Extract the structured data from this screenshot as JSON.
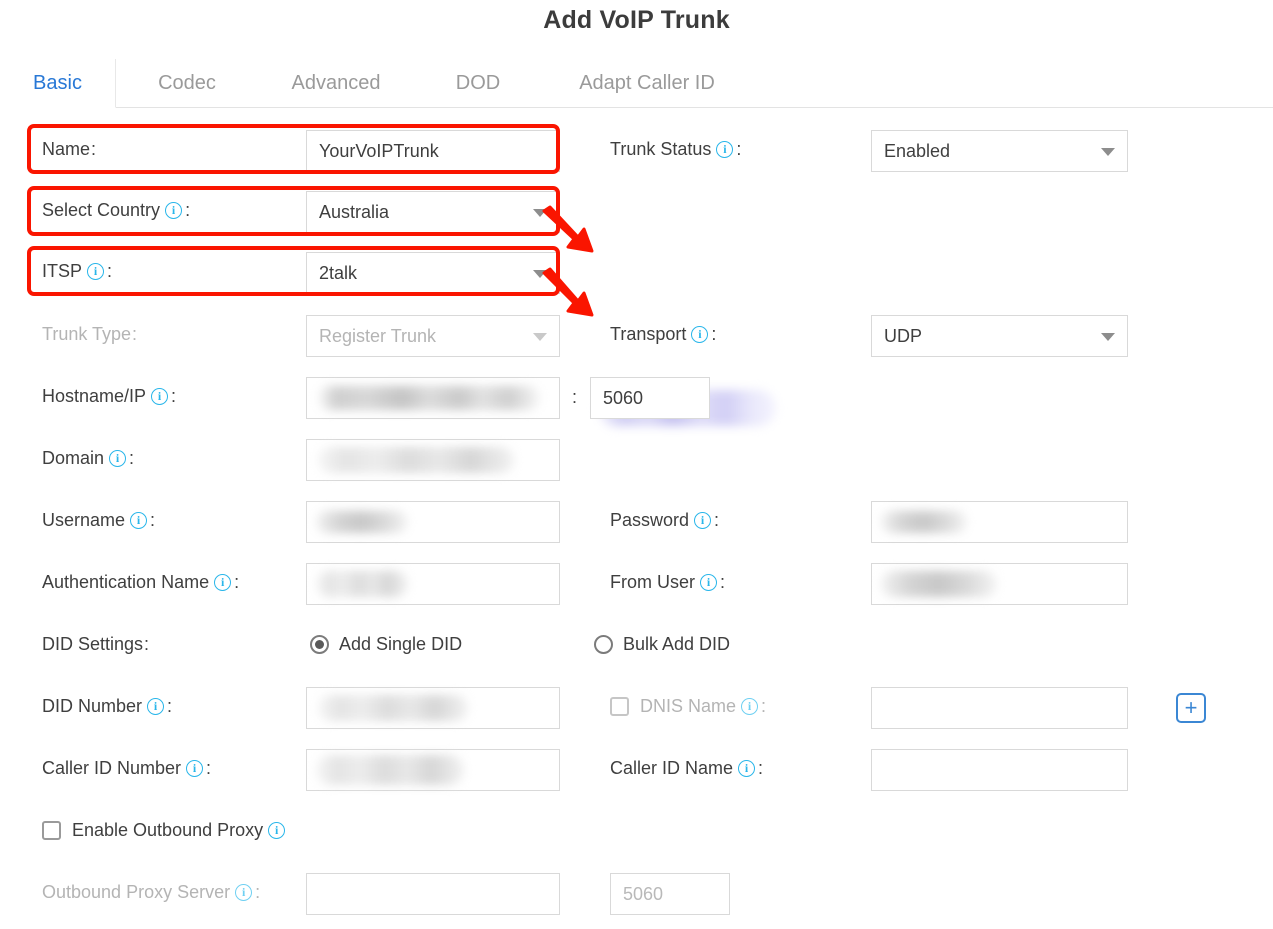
{
  "header": {
    "title": "Add VoIP Trunk"
  },
  "tabs": [
    {
      "label": "Basic",
      "active": true
    },
    {
      "label": "Codec",
      "active": false
    },
    {
      "label": "Advanced",
      "active": false
    },
    {
      "label": "DOD",
      "active": false
    },
    {
      "label": "Adapt Caller ID",
      "active": false
    }
  ],
  "form": {
    "name": {
      "label": "Name",
      "value": "YourVoIPTrunk",
      "has_info": false
    },
    "trunk_status": {
      "label": "Trunk Status",
      "value": "Enabled",
      "has_info": true
    },
    "select_country": {
      "label": "Select Country",
      "value": "Australia",
      "has_info": true
    },
    "itsp": {
      "label": "ITSP",
      "value": "2talk",
      "has_info": true
    },
    "trunk_type": {
      "label": "Trunk Type",
      "value": "Register Trunk",
      "has_info": false,
      "disabled": true
    },
    "transport": {
      "label": "Transport",
      "value": "UDP",
      "has_info": true
    },
    "hostname_ip": {
      "label": "Hostname/IP",
      "value": "",
      "has_info": true,
      "redacted": true
    },
    "hostname_port": {
      "value": "5060"
    },
    "domain": {
      "label": "Domain",
      "value": "",
      "has_info": true,
      "redacted": true
    },
    "username": {
      "label": "Username",
      "value": "",
      "has_info": true,
      "redacted": true
    },
    "password": {
      "label": "Password",
      "value": "",
      "has_info": true,
      "redacted": true
    },
    "auth_name": {
      "label": "Authentication Name",
      "value": "",
      "has_info": true,
      "redacted": true
    },
    "from_user": {
      "label": "From User",
      "value": "",
      "has_info": true,
      "redacted": true
    },
    "did_settings": {
      "label": "DID Settings"
    },
    "did_option_single": {
      "label": "Add Single DID",
      "selected": true
    },
    "did_option_bulk": {
      "label": "Bulk Add DID",
      "selected": false
    },
    "did_number": {
      "label": "DID Number",
      "value": "",
      "has_info": true,
      "redacted": true
    },
    "dnis_name": {
      "label": "DNIS Name",
      "value": "",
      "has_info": true,
      "checked": false,
      "disabled": true
    },
    "caller_id_number": {
      "label": "Caller ID Number",
      "value": "",
      "has_info": true,
      "redacted": true
    },
    "caller_id_name": {
      "label": "Caller ID Name",
      "value": "",
      "has_info": true
    },
    "enable_outbound_proxy": {
      "label": "Enable Outbound Proxy",
      "has_info": true,
      "checked": false
    },
    "outbound_proxy_server": {
      "label": "Outbound Proxy Server",
      "value": "",
      "has_info": true,
      "disabled": true
    },
    "outbound_proxy_port": {
      "value": "5060",
      "disabled": true
    },
    "add_did_button": {
      "label": "+"
    },
    "port_separator": ":"
  },
  "icons": {
    "info": "i",
    "caret_down": "caret-down-icon",
    "plus": "+"
  },
  "annotations": {
    "highlight_color": "#fa1500",
    "boxes": [
      {
        "target": "name-row"
      },
      {
        "target": "select-country-row"
      },
      {
        "target": "itsp-row"
      }
    ],
    "arrows": [
      {
        "target": "select-country-dropdown-caret"
      },
      {
        "target": "itsp-dropdown-caret"
      }
    ]
  },
  "colors": {
    "accent": "#2878d6",
    "info_icon": "#29b6ea",
    "annotation": "#fa1500",
    "text": "#3f3f3f",
    "disabled_text": "#b4b4b4",
    "border": "#d9d9d9"
  }
}
